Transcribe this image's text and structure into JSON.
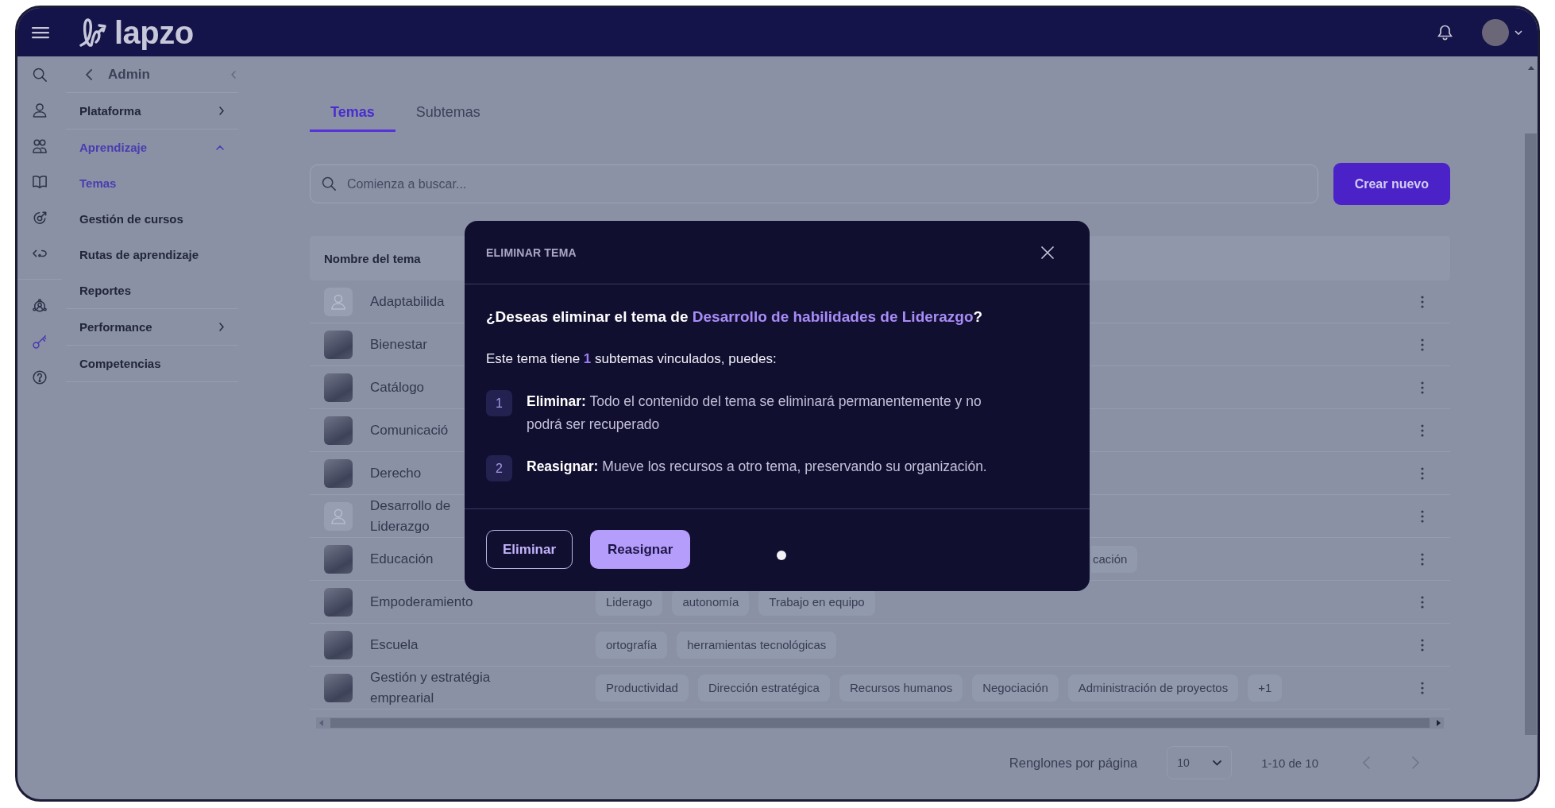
{
  "header": {
    "logo": "lapzo"
  },
  "icon_rail": {
    "top": [
      {
        "kind": "search",
        "selected": false
      },
      {
        "kind": "user",
        "selected": false
      },
      {
        "kind": "users",
        "selected": false
      },
      {
        "kind": "book",
        "selected": false
      },
      {
        "kind": "target",
        "selected": false
      },
      {
        "kind": "route",
        "selected": false
      }
    ],
    "bottom": [
      {
        "kind": "network",
        "selected": false
      },
      {
        "kind": "key",
        "selected": true
      },
      {
        "kind": "help",
        "selected": false
      }
    ]
  },
  "sidebar": {
    "back_label": "Admin",
    "items": [
      {
        "label": "Plataforma",
        "kind": "submenu",
        "selected": false,
        "expanded": false
      },
      {
        "label": "Aprendizaje",
        "kind": "group",
        "selected": true,
        "expanded": true,
        "children": [
          {
            "label": "Temas",
            "selected": true
          },
          {
            "label": "Gestión de cursos",
            "selected": false
          },
          {
            "label": "Rutas de aprendizaje",
            "selected": false
          }
        ]
      },
      {
        "label": "Reportes",
        "kind": "link",
        "selected": false,
        "expanded": false
      },
      {
        "label": "Performance",
        "kind": "submenu",
        "selected": false,
        "expanded": false
      },
      {
        "label": "Competencias",
        "kind": "link",
        "selected": false,
        "expanded": false
      }
    ]
  },
  "tabs": [
    {
      "label": "Temas",
      "selected": true
    },
    {
      "label": "Subtemas",
      "selected": false
    }
  ],
  "search": {
    "placeholder": "Comienza a buscar..."
  },
  "create_button": "Crear nuevo",
  "table": {
    "columns": [
      "Nombre del tema"
    ],
    "rows": [
      {
        "thumbnail": {
          "kind": "placeholder"
        },
        "name": "Adaptabilida",
        "under_dialog": true
      },
      {
        "thumbnail": {
          "kind": "photo"
        },
        "name": "Bienestar",
        "under_dialog": true
      },
      {
        "thumbnail": {
          "kind": "photo"
        },
        "name": "Catálogo",
        "under_dialog": true
      },
      {
        "thumbnail": {
          "kind": "photo"
        },
        "name": "Comunicació",
        "under_dialog": true
      },
      {
        "thumbnail": {
          "kind": "photo"
        },
        "name": "Derecho",
        "under_dialog": true
      },
      {
        "thumbnail": {
          "kind": "placeholder"
        },
        "name": "Desarrollo de Liderazgo",
        "under_dialog": true
      },
      {
        "thumbnail": {
          "kind": "photo"
        },
        "name": "Educación",
        "under_dialog": true,
        "tags": [
          "cación"
        ]
      },
      {
        "thumbnail": {
          "kind": "photo"
        },
        "name": "Empoderamiento",
        "under_dialog": false,
        "tags": [
          "Liderago",
          "autonomía",
          "Trabajo en equipo"
        ]
      },
      {
        "thumbnail": {
          "kind": "photo"
        },
        "name": "Escuela",
        "under_dialog": false,
        "tags": [
          "ortografía",
          "herramientas tecnológicas"
        ]
      },
      {
        "thumbnail": {
          "kind": "photo"
        },
        "name": "Gestión y estratégia emprearial",
        "under_dialog": false,
        "tags": [
          "Productividad",
          "Dirección estratégica",
          "Recursos humanos",
          "Negociación",
          "Administración de proyectos",
          "+1"
        ]
      }
    ]
  },
  "pagination": {
    "rows_per_page_label": "Renglones por página",
    "page_size": "10",
    "range": "1-10 de 10",
    "prev_disabled": true,
    "next_disabled": true
  },
  "dialog": {
    "title": "ELIMINAR TEMA",
    "question": {
      "before": "¿Deseas eliminar el tema de ",
      "topic": "Desarrollo de habilidades de Liderazgo",
      "after": "?"
    },
    "info": {
      "before": "Este tema tiene ",
      "count": "1",
      "after": " subtemas vinculados, puedes:"
    },
    "steps": [
      {
        "number": "1",
        "text": "**Eliminar:** Todo el contenido del tema se eliminará permanentemente y no podrá ser recuperado"
      },
      {
        "number": "2",
        "text": "**Reasignar:** Mueve los recursos a otro tema, preservando su organización."
      }
    ],
    "buttons": [
      {
        "label": "Eliminar",
        "kind": "outline"
      },
      {
        "label": "Reasignar",
        "kind": "filled"
      }
    ]
  }
}
